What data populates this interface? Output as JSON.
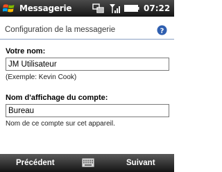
{
  "statusbar": {
    "app_title": "Messagerie",
    "time": "07:22",
    "icons": [
      "windows-start-icon",
      "connectivity-icon",
      "signal-strength-icon",
      "battery-icon"
    ]
  },
  "header": {
    "title": "Configuration de la messagerie",
    "help_icon": "help-icon"
  },
  "form": {
    "name_label": "Votre nom:",
    "name_value": "JM Utilisateur",
    "name_hint": "(Exemple: Kevin Cook)",
    "account_label": "Nom d'affichage du compte:",
    "account_value": "Bureau",
    "account_hint": "Nom de ce compte sur cet appareil."
  },
  "softkeys": {
    "left": "Précédent",
    "right": "Suivant",
    "center_icon": "keyboard-icon"
  },
  "colors": {
    "titlebar": "#1e1e1e",
    "divider": "#8aa0c4",
    "help_icon": "#2f5fb0"
  }
}
